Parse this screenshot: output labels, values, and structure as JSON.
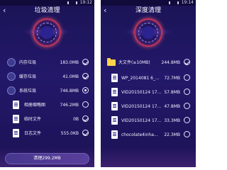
{
  "left": {
    "status_time": "19:12",
    "back_symbol": "‹",
    "title": "垃圾清理",
    "items": [
      {
        "label": "内存垃圾",
        "value": "183.0MB",
        "icon": "memory-icon",
        "state": "checked"
      },
      {
        "label": "缓存垃圾",
        "value": "41.0MB",
        "icon": "cache-icon",
        "state": "checked"
      },
      {
        "label": "系统垃圾",
        "value": "746.8MB",
        "icon": "system-icon",
        "state": "partial"
      },
      {
        "label": "相册缩略图",
        "value": "746.2MB",
        "icon": "thumbnail-icon",
        "state": "unchecked"
      },
      {
        "label": "临时文件",
        "value": "0B",
        "icon": "temp-file-icon",
        "state": "checked"
      },
      {
        "label": "日志文件",
        "value": "555.0KB",
        "icon": "log-file-icon",
        "state": "checked"
      }
    ],
    "clean_button": "清理299.2MB"
  },
  "right": {
    "status_time": "19:14",
    "back_symbol": "‹",
    "title": "深度清理",
    "group": {
      "label": "大文件(≥10MB)",
      "value": "244.8MB",
      "icon": "folder-icon",
      "state": "checked"
    },
    "files": [
      {
        "label": "WP_2014081 6_...",
        "value": "72.7MB",
        "icon": "file-icon",
        "state": "unchecked"
      },
      {
        "label": "VID20150124 17...",
        "value": "57.8MB",
        "icon": "file-icon",
        "state": "unchecked"
      },
      {
        "label": "VID20150124 17...",
        "value": "47.8MB",
        "icon": "file-icon",
        "state": "unchecked"
      },
      {
        "label": "VID20150124 17...",
        "value": "33.3MB",
        "icon": "file-icon",
        "state": "unchecked"
      },
      {
        "label": "chocolate4inha...",
        "value": "22.3MB",
        "icon": "file-icon",
        "state": "unchecked"
      }
    ]
  }
}
